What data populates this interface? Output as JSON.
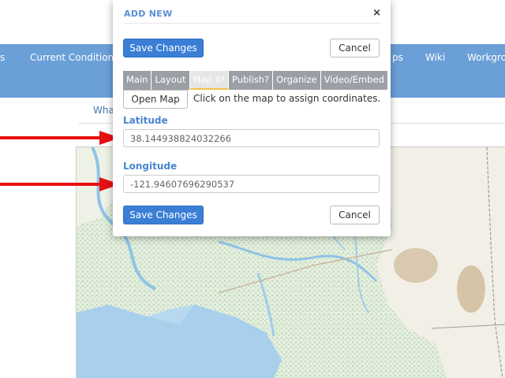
{
  "nav": {
    "items": [
      {
        "label": "s"
      },
      {
        "label": "Current Conditions"
      },
      {
        "label": "ps"
      },
      {
        "label": "Wiki"
      },
      {
        "label": "Workgrou"
      }
    ]
  },
  "subnav": {
    "link": "What"
  },
  "modal": {
    "title": "ADD NEW",
    "close_icon": "×",
    "save_label": "Save Changes",
    "cancel_label": "Cancel",
    "tabs": [
      {
        "label": "Main",
        "active": false
      },
      {
        "label": "Layout",
        "active": false
      },
      {
        "label": "Map It!",
        "active": true
      },
      {
        "label": "Publish?",
        "active": false
      },
      {
        "label": "Organize",
        "active": false
      },
      {
        "label": "Video/Embed",
        "active": false
      }
    ],
    "open_map_label": "Open Map",
    "open_map_hint": "Click on the map to assign coordinates.",
    "latitude": {
      "label": "Latitude",
      "value": "38.144938824032266"
    },
    "longitude": {
      "label": "Longitude",
      "value": "-121.94607696290537"
    }
  },
  "colors": {
    "nav_bg": "#6b9fd8",
    "primary_button": "#3a7fd5",
    "label_blue": "#4a85d0",
    "arrow_red": "#e81010"
  },
  "icons": {
    "close": "close-icon",
    "arrow": "red-arrow-icon"
  }
}
